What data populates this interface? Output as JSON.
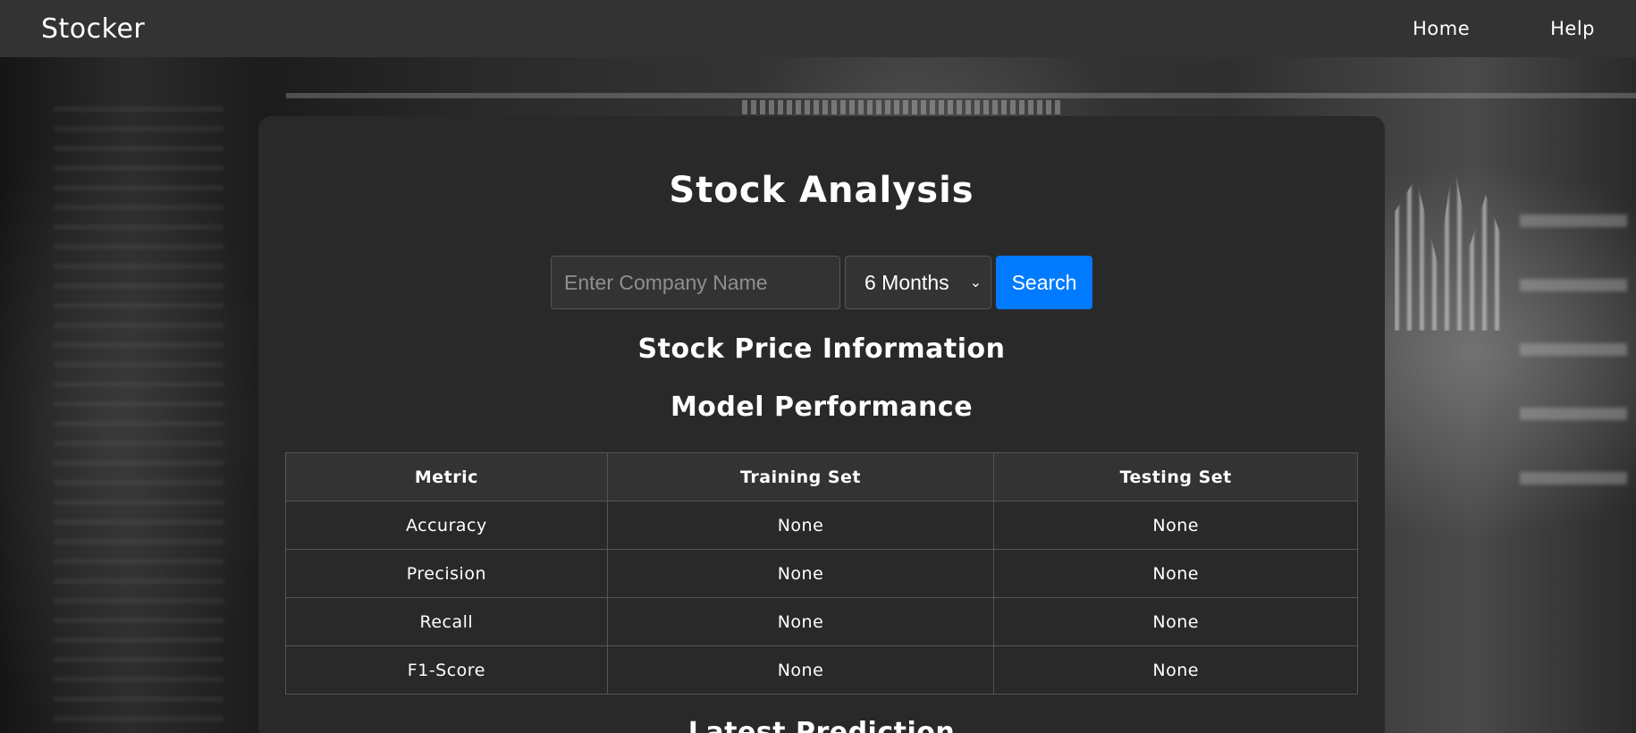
{
  "nav": {
    "brand": "Stocker",
    "links": [
      "Home",
      "Help"
    ]
  },
  "main": {
    "title": "Stock Analysis",
    "search": {
      "placeholder": "Enter Company Name",
      "period_selected": "6 Months",
      "button_label": "Search"
    },
    "sections": {
      "price_info": "Stock Price Information",
      "model_performance": "Model Performance",
      "latest_prediction": "Latest Prediction"
    },
    "table": {
      "headers": [
        "Metric",
        "Training Set",
        "Testing Set"
      ],
      "rows": [
        [
          "Accuracy",
          "None",
          "None"
        ],
        [
          "Precision",
          "None",
          "None"
        ],
        [
          "Recall",
          "None",
          "None"
        ],
        [
          "F1-Score",
          "None",
          "None"
        ]
      ]
    }
  },
  "colors": {
    "navbar": "#333333",
    "card": "#292929",
    "button_accent": "#007bff",
    "text": "#ffffff"
  },
  "icons": {
    "select_arrow": "chevron-down-icon"
  }
}
